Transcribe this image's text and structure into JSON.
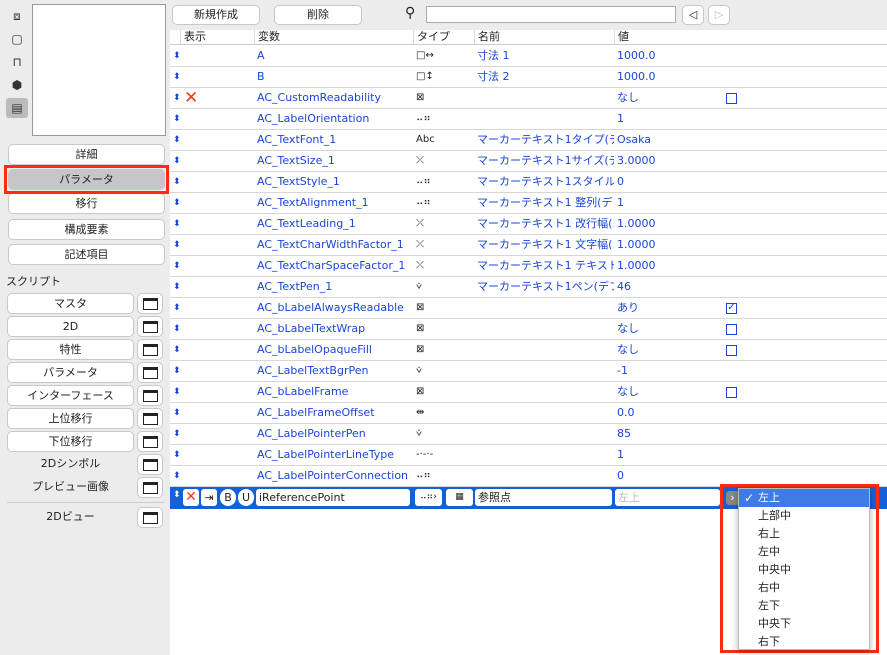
{
  "left": {
    "view_icons": [
      "2d-symbol-icon",
      "floor-plan-icon",
      "section-icon",
      "3d-icon",
      "parameter-list-icon"
    ],
    "buttons": [
      "詳細",
      "パラメータ",
      "移行",
      "構成要素",
      "記述項目"
    ],
    "selected_button": "パラメータ",
    "scripts_label": "スクリプト",
    "script_buttons": [
      "マスタ",
      "2D",
      "特性",
      "パラメータ",
      "インターフェース",
      "上位移行",
      "下位移行"
    ],
    "script_labels": [
      "2Dシンボル",
      "プレビュー画像"
    ],
    "view_label": "2Dビュー"
  },
  "toolbar": {
    "new_label": "新規作成",
    "delete_label": "削除",
    "search_value": ""
  },
  "table": {
    "headers": [
      "表示",
      "変数",
      "タイプ",
      "名前",
      "値"
    ],
    "rows": [
      {
        "var": "A",
        "type": "length-x",
        "type_glyph": "□↔",
        "name": "寸法 1",
        "value": "1000.0"
      },
      {
        "var": "B",
        "type": "length-y",
        "type_glyph": "□↕",
        "name": "寸法 2",
        "value": "1000.0"
      },
      {
        "var": "AC_CustomReadability",
        "type": "boolean",
        "type_glyph": "⊠",
        "name": "",
        "value": "なし",
        "hidden": true,
        "checkbox": false
      },
      {
        "var": "AC_LabelOrientation",
        "type": "integer",
        "type_glyph": "⠤⠶",
        "name": "",
        "value": "1"
      },
      {
        "var": "AC_TextFont_1",
        "type": "string",
        "type_glyph": "Abc",
        "name": "マーカーテキスト1タイプ(デ…",
        "value": "Osaka"
      },
      {
        "var": "AC_TextSize_1",
        "type": "real",
        "type_glyph": "⤫",
        "name": "マーカーテキスト1サイズ(デ…",
        "value": "3.0000"
      },
      {
        "var": "AC_TextStyle_1",
        "type": "integer",
        "type_glyph": "⠤⠶",
        "name": "マーカーテキスト1スタイル(…",
        "value": "0"
      },
      {
        "var": "AC_TextAlignment_1",
        "type": "integer",
        "type_glyph": "⠤⠶",
        "name": "マーカーテキスト1 整列(デフ…",
        "value": "1"
      },
      {
        "var": "AC_TextLeading_1",
        "type": "real",
        "type_glyph": "⤫",
        "name": "マーカーテキスト1 改行幅(…",
        "value": "1.0000"
      },
      {
        "var": "AC_TextCharWidthFactor_1",
        "type": "real",
        "type_glyph": "⤫",
        "name": "マーカーテキスト1 文字幅(…",
        "value": "1.0000"
      },
      {
        "var": "AC_TextCharSpaceFactor_1",
        "type": "real",
        "type_glyph": "⤫",
        "name": "マーカーテキスト1 テキスト…",
        "value": "1.0000"
      },
      {
        "var": "AC_TextPen_1",
        "type": "pen",
        "type_glyph": "⩒",
        "name": "マーカーテキスト1ペン(デフ…",
        "value": "46"
      },
      {
        "var": "AC_bLabelAlwaysReadable",
        "type": "boolean",
        "type_glyph": "⊠",
        "name": "",
        "value": "あり",
        "checkbox": true
      },
      {
        "var": "AC_bLabelTextWrap",
        "type": "boolean",
        "type_glyph": "⊠",
        "name": "",
        "value": "なし",
        "checkbox": false
      },
      {
        "var": "AC_bLabelOpaqueFill",
        "type": "boolean",
        "type_glyph": "⊠",
        "name": "",
        "value": "なし",
        "checkbox": false
      },
      {
        "var": "AC_LabelTextBgrPen",
        "type": "pen",
        "type_glyph": "⩒",
        "name": "",
        "value": "-1"
      },
      {
        "var": "AC_bLabelFrame",
        "type": "boolean",
        "type_glyph": "⊠",
        "name": "",
        "value": "なし",
        "checkbox": false
      },
      {
        "var": "AC_LabelFrameOffset",
        "type": "length",
        "type_glyph": "⇹",
        "name": "",
        "value": "0.0"
      },
      {
        "var": "AC_LabelPointerPen",
        "type": "pen",
        "type_glyph": "⩒",
        "name": "",
        "value": "85"
      },
      {
        "var": "AC_LabelPointerLineType",
        "type": "line-type",
        "type_glyph": "-·-·-",
        "name": "",
        "value": "1"
      },
      {
        "var": "AC_LabelPointerConnection",
        "type": "integer",
        "type_glyph": "⠤⠶",
        "name": "",
        "value": "0"
      }
    ],
    "selected": {
      "var": "iReferencePoint",
      "name": "参照点",
      "value": "左上",
      "flags": [
        "B",
        "U"
      ]
    }
  },
  "dropdown": {
    "options": [
      "左上",
      "上部中",
      "右上",
      "左中",
      "中央中",
      "右中",
      "左下",
      "中央下",
      "右下"
    ],
    "selected": "左上"
  },
  "colors": {
    "accent": "#1560d8",
    "link": "#1a45d8",
    "highlight": "#ff2a12"
  }
}
